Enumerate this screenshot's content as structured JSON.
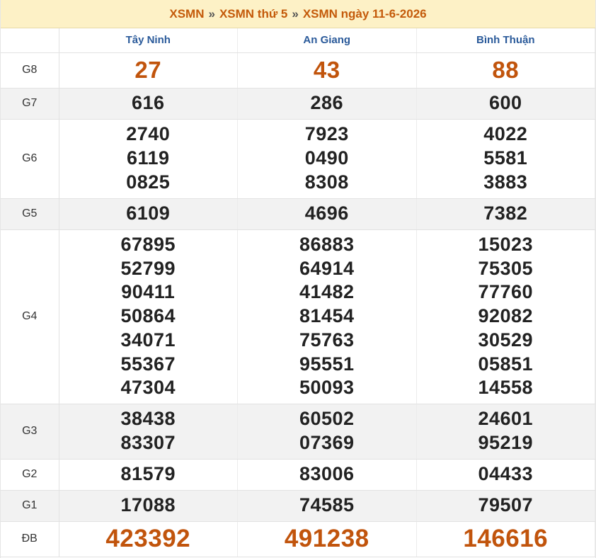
{
  "breadcrumb": {
    "items": [
      "XSMN",
      "XSMN thứ 5",
      "XSMN ngày 11-6-2026"
    ],
    "separator": "»"
  },
  "provinces": [
    "Tây Ninh",
    "An Giang",
    "Bình Thuận"
  ],
  "prizes": [
    {
      "label": "G8",
      "results": [
        [
          "27"
        ],
        [
          "43"
        ],
        [
          "88"
        ]
      ]
    },
    {
      "label": "G7",
      "results": [
        [
          "616"
        ],
        [
          "286"
        ],
        [
          "600"
        ]
      ]
    },
    {
      "label": "G6",
      "results": [
        [
          "2740",
          "6119",
          "0825"
        ],
        [
          "7923",
          "0490",
          "8308"
        ],
        [
          "4022",
          "5581",
          "3883"
        ]
      ]
    },
    {
      "label": "G5",
      "results": [
        [
          "6109"
        ],
        [
          "4696"
        ],
        [
          "7382"
        ]
      ]
    },
    {
      "label": "G4",
      "results": [
        [
          "67895",
          "52799",
          "90411",
          "50864",
          "34071",
          "55367",
          "47304"
        ],
        [
          "86883",
          "64914",
          "41482",
          "81454",
          "75763",
          "95551",
          "50093"
        ],
        [
          "15023",
          "75305",
          "77760",
          "92082",
          "30529",
          "05851",
          "14558"
        ]
      ]
    },
    {
      "label": "G3",
      "results": [
        [
          "38438",
          "83307"
        ],
        [
          "60502",
          "07369"
        ],
        [
          "24601",
          "95219"
        ]
      ]
    },
    {
      "label": "G2",
      "results": [
        [
          "81579"
        ],
        [
          "83006"
        ],
        [
          "04433"
        ]
      ]
    },
    {
      "label": "G1",
      "results": [
        [
          "17088"
        ],
        [
          "74585"
        ],
        [
          "79507"
        ]
      ]
    },
    {
      "label": "ĐB",
      "results": [
        [
          "423392"
        ],
        [
          "491238"
        ],
        [
          "146616"
        ]
      ]
    }
  ],
  "colors": {
    "accent": "#c1540c",
    "header_bg": "#fdf1c6",
    "province_text": "#2a5a9a",
    "alt_row_bg": "#f2f2f2"
  }
}
